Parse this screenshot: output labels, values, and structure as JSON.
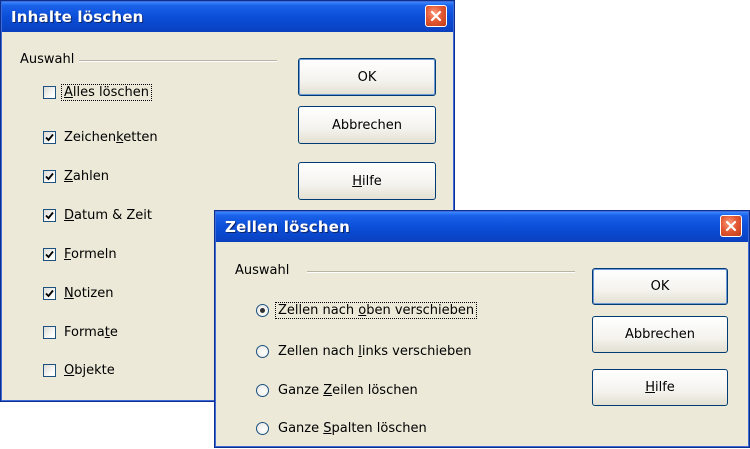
{
  "dialog_delete_contents": {
    "title": "Inhalte löschen",
    "group_label": "Auswahl",
    "checkboxes": [
      {
        "pre": "",
        "u": "A",
        "post": "lles löschen",
        "checked": false,
        "focused": true
      },
      {
        "pre": "Zeichen",
        "u": "k",
        "post": "etten",
        "checked": true,
        "focused": false
      },
      {
        "pre": "",
        "u": "Z",
        "post": "ahlen",
        "checked": true,
        "focused": false
      },
      {
        "pre": "",
        "u": "D",
        "post": "atum & Zeit",
        "checked": true,
        "focused": false
      },
      {
        "pre": "",
        "u": "F",
        "post": "ormeln",
        "checked": true,
        "focused": false
      },
      {
        "pre": "",
        "u": "N",
        "post": "otizen",
        "checked": true,
        "focused": false
      },
      {
        "pre": "Forma",
        "u": "t",
        "post": "e",
        "checked": false,
        "focused": false
      },
      {
        "pre": "",
        "u": "O",
        "post": "bjekte",
        "checked": false,
        "focused": false
      }
    ],
    "buttons": {
      "ok": "OK",
      "cancel": "Abbrechen",
      "help_u": "H",
      "help_rest": "ilfe"
    }
  },
  "dialog_delete_cells": {
    "title": "Zellen löschen",
    "group_label": "Auswahl",
    "radios": [
      {
        "pre": "Zellen nach ",
        "u": "o",
        "post": "ben verschieben",
        "selected": true,
        "focused": true
      },
      {
        "pre": "Zellen nach ",
        "u": "l",
        "post": "inks verschieben",
        "selected": false,
        "focused": false
      },
      {
        "pre": "Ganze ",
        "u": "Z",
        "post": "eilen löschen",
        "selected": false,
        "focused": false
      },
      {
        "pre": "Ganze ",
        "u": "S",
        "post": "palten löschen",
        "selected": false,
        "focused": false
      }
    ],
    "buttons": {
      "ok": "OK",
      "cancel": "Abbrechen",
      "help_u": "H",
      "help_rest": "ilfe"
    }
  },
  "icons": {
    "close": "close-icon",
    "check": "check-icon"
  },
  "colors": {
    "titlebar": "#0b4ed7",
    "dialog_bg": "#ece9d8",
    "close_button": "#d8512b"
  }
}
